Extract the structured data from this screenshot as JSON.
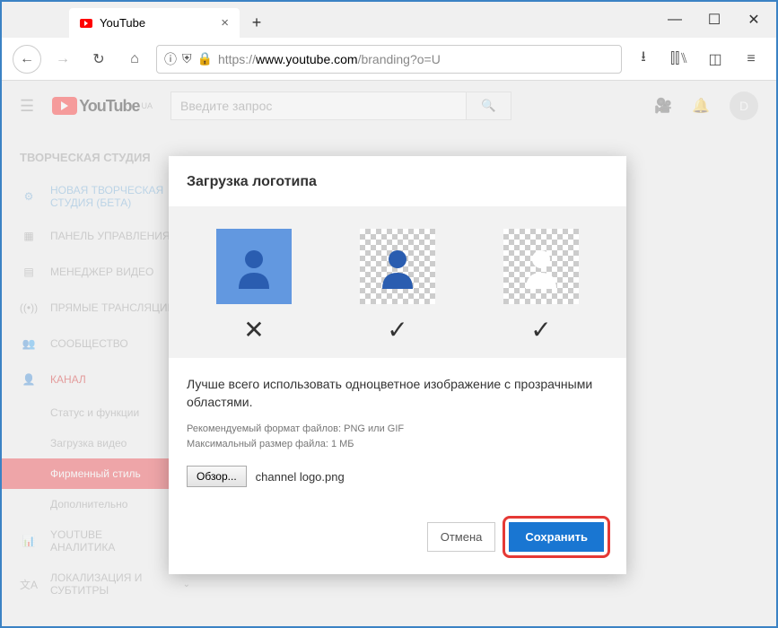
{
  "window": {
    "tab_title": "YouTube"
  },
  "nav": {
    "url_prefix": "https://",
    "url_host": "www.youtube.com",
    "url_path": "/branding?o=U"
  },
  "yt": {
    "logo_text": "YouTube",
    "logo_sup": "UA",
    "search_placeholder": "Введите запрос",
    "avatar_letter": "D"
  },
  "sidebar": {
    "title": "ТВОРЧЕСКАЯ СТУДИЯ",
    "item_new_studio_l1": "НОВАЯ ТВОРЧЕСКАЯ",
    "item_new_studio_l2": "СТУДИЯ (БЕТА)",
    "item_dashboard": "ПАНЕЛЬ УПРАВЛЕНИЯ",
    "item_video_manager": "МЕНЕДЖЕР ВИДЕО",
    "item_live": "ПРЯМЫЕ ТРАНСЛЯЦИИ",
    "item_community": "СООБЩЕСТВО",
    "item_channel": "КАНАЛ",
    "sub_status": "Статус и функции",
    "sub_upload": "Загрузка видео",
    "sub_branding": "Фирменный стиль",
    "sub_advanced": "Дополнительно",
    "item_analytics": "YOUTUBE АНАЛИТИКА",
    "item_localization_l1": "ЛОКАЛИЗАЦИЯ И",
    "item_localization_l2": "СУБТИТРЫ"
  },
  "modal": {
    "title": "Загрузка логотипа",
    "desc": "Лучше всего использовать одноцветное изображение с прозрачными областями.",
    "hint_line1": "Рекомендуемый формат файлов: PNG или GIF",
    "hint_line2": "Максимальный размер файла: 1 МБ",
    "browse": "Обзор...",
    "filename": "channel logo.png",
    "cancel": "Отмена",
    "save": "Сохранить"
  }
}
